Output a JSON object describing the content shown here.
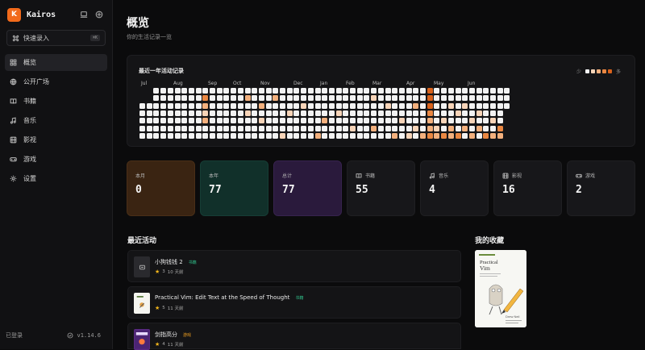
{
  "sidebar": {
    "brand_letter": "K",
    "brand_name": "Kairos",
    "quick_entry": {
      "label": "快速录入",
      "shortcut": "⌘K"
    },
    "items": [
      {
        "label": "概览",
        "icon": "grid-icon",
        "active": true
      },
      {
        "label": "公开广场",
        "icon": "globe-icon"
      },
      {
        "label": "书籍",
        "icon": "book-icon"
      },
      {
        "label": "音乐",
        "icon": "music-icon"
      },
      {
        "label": "影视",
        "icon": "film-icon"
      },
      {
        "label": "游戏",
        "icon": "gamepad-icon"
      },
      {
        "label": "设置",
        "icon": "gear-icon"
      }
    ],
    "footer": {
      "status": "已登录",
      "version": "v1.14.6"
    }
  },
  "header": {
    "title": "概览",
    "subtitle": "你的生活记录一览"
  },
  "heatmap": {
    "title": "最近一年活动记录",
    "legend_less": "少",
    "legend_more": "多",
    "legend_colors": [
      "#f2f2f2",
      "#f7d4b8",
      "#f3b07d",
      "#ea8742",
      "#d9621c"
    ],
    "months": [
      "Jul",
      "Aug",
      "Sep",
      "Oct",
      "Nov",
      "Dec",
      "Jan",
      "Feb",
      "Mar",
      "Apr",
      "May",
      "Jun"
    ]
  },
  "stats": [
    {
      "label": "本月",
      "value": "0"
    },
    {
      "label": "本年",
      "value": "77"
    },
    {
      "label": "总计",
      "value": "77"
    },
    {
      "label": "书籍",
      "value": "55",
      "icon": "book-icon"
    },
    {
      "label": "音乐",
      "value": "4",
      "icon": "music-icon"
    },
    {
      "label": "影视",
      "value": "16",
      "icon": "film-icon"
    },
    {
      "label": "游戏",
      "value": "2",
      "icon": "gamepad-icon"
    }
  ],
  "recent": {
    "title": "最近活动",
    "items": [
      {
        "title": "小狗钱钱 2",
        "tag": "书籍",
        "tag_color": "#31c48d",
        "rating": "3",
        "time": "10 天前"
      },
      {
        "title": "Practical Vim: Edit Text at the Speed of Thought",
        "tag": "书籍",
        "tag_color": "#31c48d",
        "rating": "5",
        "time": "11 天前"
      },
      {
        "title": "剑指高分",
        "tag": "游戏",
        "tag_color": "#f0a020",
        "rating": "4",
        "time": "11 天前"
      }
    ]
  },
  "favorites": {
    "title": "我的收藏",
    "book": {
      "title_line1": "Practical",
      "title_line2": "Vim",
      "author": "Drew Neil"
    }
  }
}
